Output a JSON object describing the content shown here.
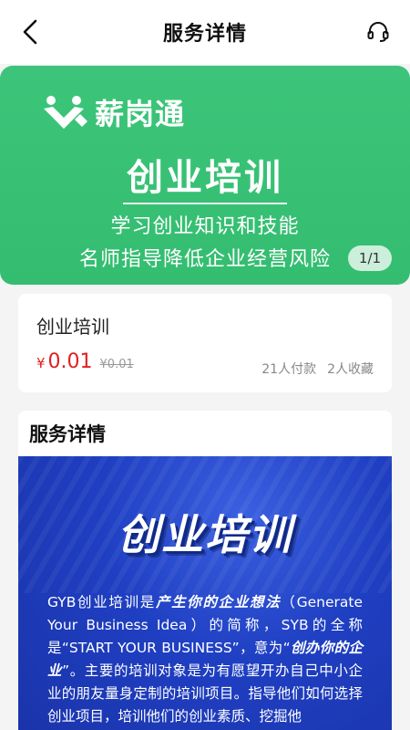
{
  "header": {
    "title": "服务详情"
  },
  "banner": {
    "brand": "薪岗通",
    "heading": "创业培训",
    "line1": "学习创业知识和技能",
    "line2": "名师指导降低企业经营风险",
    "pager": "1/1"
  },
  "product": {
    "name": "创业培训",
    "currency": "¥",
    "price": "0.01",
    "original_price": "¥0.01",
    "paid_count": "21人付款",
    "fav_count": "2人收藏"
  },
  "detail": {
    "title": "服务详情",
    "poster_heading": "创业培训",
    "text_part1": "GYB创业培训是",
    "text_bold1": "产生你的企业想法",
    "text_part2": "（Generate Your Business Idea）的简称，SYB的全称是“START YOUR BUSINESS”，意为“",
    "text_bold2": "创办你的企业",
    "text_part3": "”。主要的培训对象是为有愿望开办自己中小企业的朋友量身定制的培训项目。指导他们如何选择创业项目，培训他们的创业素质、挖掘他"
  },
  "colors": {
    "banner_green": "#3cc57a",
    "price_red": "#e02020",
    "poster_blue": "#1f3fc2"
  },
  "icons": {
    "back": "chevron-left-icon",
    "customer_service": "headset-icon",
    "brand_logo": "brand-logo-icon"
  }
}
